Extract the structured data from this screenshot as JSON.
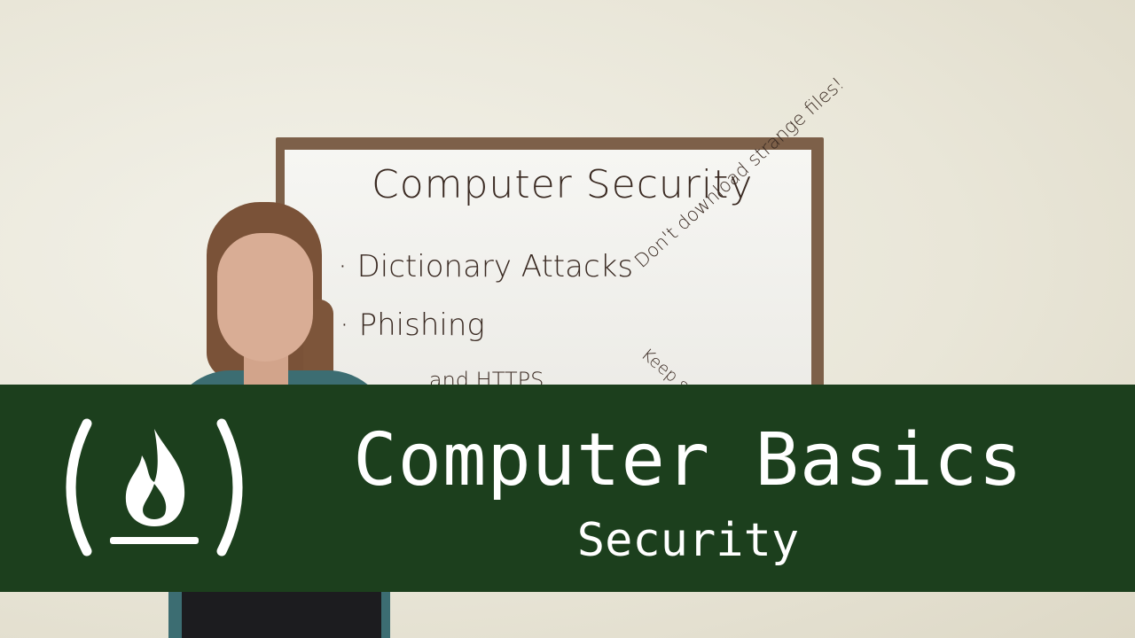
{
  "whiteboard": {
    "title": "Computer Security",
    "items": [
      "· Dictionary Attacks",
      "· Phishing",
      "...and HTTPS"
    ],
    "side_note_1": "Don't download strange files!",
    "side_note_2": "Keep soft..."
  },
  "banner": {
    "logo": "freeCodeCamp ( fire )",
    "title": "Computer Basics",
    "subtitle": "Security",
    "background_color": "#1c3f1d",
    "text_color": "#ffffff"
  }
}
